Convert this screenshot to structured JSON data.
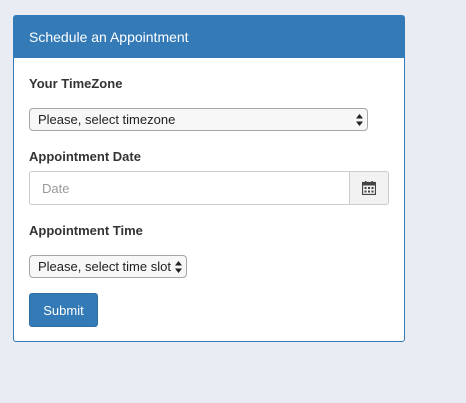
{
  "panel": {
    "title": "Schedule an Appointment"
  },
  "form": {
    "timezone": {
      "label": "Your TimeZone",
      "selected": "Please, select timezone"
    },
    "date": {
      "label": "Appointment Date",
      "placeholder": "Date",
      "icon": "calendar-icon"
    },
    "time": {
      "label": "Appointment Time",
      "selected": "Please, select time slot"
    },
    "submit_label": "Submit"
  },
  "colors": {
    "primary": "#337ab7",
    "background": "#e9edf3"
  }
}
